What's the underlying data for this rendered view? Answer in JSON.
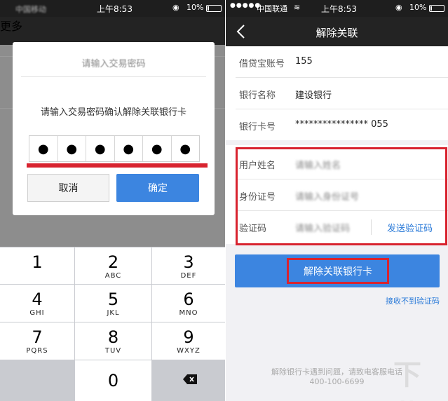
{
  "left": {
    "status": {
      "carrier": "中国移动",
      "time": "上午8:53",
      "lock": "◉",
      "battery": "10%"
    },
    "header": {
      "more": "更多"
    },
    "dialog": {
      "title": "请输入交易密码",
      "message": "请输入交易密码确认解除关联银行卡",
      "pin": [
        "●",
        "●",
        "●",
        "●",
        "●",
        "●"
      ],
      "cancel": "取消",
      "confirm": "确定"
    },
    "keypad": [
      {
        "num": "1",
        "letters": ""
      },
      {
        "num": "2",
        "letters": "ABC"
      },
      {
        "num": "3",
        "letters": "DEF"
      },
      {
        "num": "4",
        "letters": "GHI"
      },
      {
        "num": "5",
        "letters": "JKL"
      },
      {
        "num": "6",
        "letters": "MNO"
      },
      {
        "num": "7",
        "letters": "PQRS"
      },
      {
        "num": "8",
        "letters": "TUV"
      },
      {
        "num": "9",
        "letters": "WXYZ"
      },
      {
        "num": "0",
        "letters": ""
      }
    ]
  },
  "right": {
    "status": {
      "signal": "●●●●●",
      "carrier": "中国联通",
      "wifi": "≋",
      "time": "上午8:53",
      "lock": "◉",
      "battery": "10%"
    },
    "nav": {
      "title": "解除关联"
    },
    "info": [
      {
        "label": "借贷宝账号",
        "value": "155"
      },
      {
        "label": "银行名称",
        "value": "建设银行"
      },
      {
        "label": "银行卡号",
        "value": "****************  055"
      }
    ],
    "form": {
      "name_label": "用户姓名",
      "name_value": "请输入姓名",
      "id_label": "身份证号",
      "id_value": "请输入身份证号",
      "code_label": "验证码",
      "code_value": "请输入验证码",
      "send_code": "发送验证码"
    },
    "submit": "解除关联银行卡",
    "no_code": "接收不到验证码",
    "help_line1": "解除银行卡遇到问题，请致电客服电话",
    "help_line2": "400-100-6699",
    "watermark": "下载"
  },
  "colors": {
    "accent": "#3c85e0",
    "highlight_red": "#d8232f",
    "link": "#2a7ad8"
  }
}
